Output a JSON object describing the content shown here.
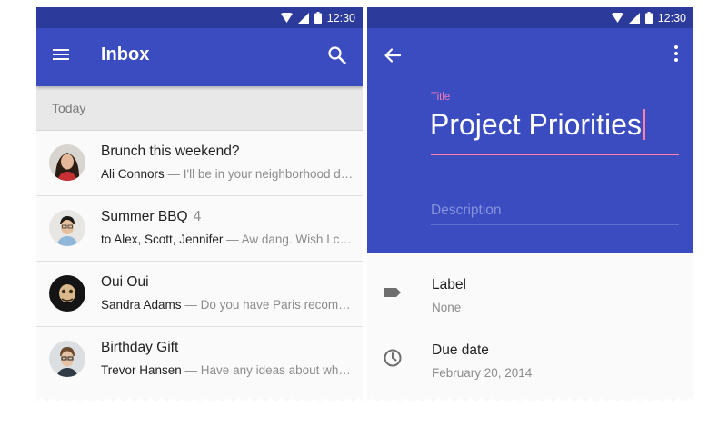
{
  "status_bar": {
    "time": "12:30"
  },
  "inbox": {
    "title": "Inbox",
    "section_header": "Today",
    "messages": [
      {
        "subject": "Brunch this weekend?",
        "count": "",
        "sender": "Ali Connors",
        "snippet": " — I'll be in your neighborhood doing errands this weekend."
      },
      {
        "subject": "Summer BBQ",
        "count": "4",
        "sender": "to Alex, Scott, Jennifer",
        "snippet": " — Aw dang. Wish I could make it."
      },
      {
        "subject": "Oui Oui",
        "count": "",
        "sender": "Sandra Adams",
        "snippet": " — Do you have Paris recommendations?"
      },
      {
        "subject": "Birthday Gift",
        "count": "",
        "sender": "Trevor Hansen",
        "snippet": " — Have any ideas about what to get?"
      }
    ]
  },
  "editor": {
    "title_label": "Title",
    "title_value": "Project Priorities",
    "description_placeholder": "Description",
    "details": [
      {
        "label": "Label",
        "value": "None",
        "icon": "label-tag-icon"
      },
      {
        "label": "Due date",
        "value": "February 20, 2014",
        "icon": "clock-icon"
      }
    ]
  },
  "colors": {
    "primary": "#3a4cc0",
    "primary_dark": "#2c3a9c",
    "accent": "#ff80ab",
    "background": "#fafafa"
  }
}
